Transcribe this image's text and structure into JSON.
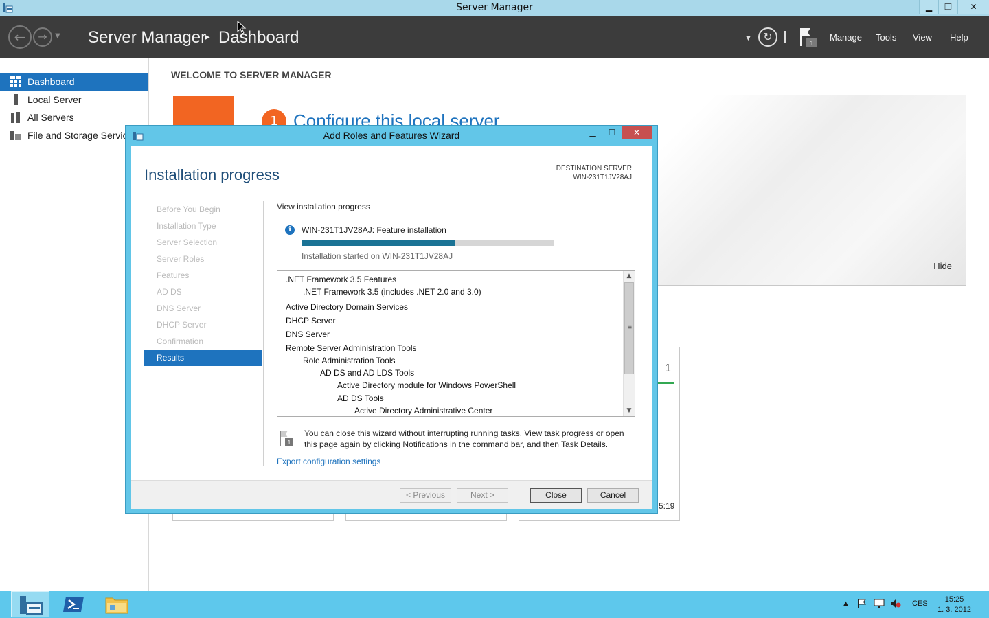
{
  "window": {
    "title": "Server Manager"
  },
  "header": {
    "breadcrumb_root": "Server Manager",
    "breadcrumb_current": "Dashboard",
    "notification_count": "1",
    "menus": [
      "Manage",
      "Tools",
      "View",
      "Help"
    ]
  },
  "sidebar": {
    "items": [
      {
        "label": "Dashboard",
        "active": true
      },
      {
        "label": "Local Server"
      },
      {
        "label": "All Servers"
      },
      {
        "label": "File and Storage Services"
      }
    ]
  },
  "main": {
    "welcome_heading": "WELCOME TO SERVER MANAGER",
    "step_number": "1",
    "configure_text": "Configure this local server",
    "hide_label": "Hide",
    "tile_count": "1",
    "tile_time": "5:19"
  },
  "dialog": {
    "title": "Add Roles and Features Wizard",
    "page_title": "Installation progress",
    "destination_label": "DESTINATION SERVER",
    "destination_server": "WIN-231T1JV28AJ",
    "steps": [
      "Before You Begin",
      "Installation Type",
      "Server Selection",
      "Server Roles",
      "Features",
      "AD DS",
      "DNS Server",
      "DHCP Server",
      "Confirmation",
      "Results"
    ],
    "active_step": "Results",
    "view_progress": "View installation progress",
    "feature_install": "WIN-231T1JV28AJ: Feature installation",
    "progress_percent": 61,
    "started_text": "Installation started on WIN-231T1JV28AJ",
    "features": [
      {
        "text": ".NET Framework 3.5 Features",
        "level": 0
      },
      {
        "text": ".NET Framework 3.5 (includes .NET 2.0 and 3.0)",
        "level": 1
      },
      {
        "text": "Active Directory Domain Services",
        "level": 0
      },
      {
        "text": "DHCP Server",
        "level": 0
      },
      {
        "text": "DNS Server",
        "level": 0
      },
      {
        "text": "Remote Server Administration Tools",
        "level": 0
      },
      {
        "text": "Role Administration Tools",
        "level": 1
      },
      {
        "text": "AD DS and AD LDS Tools",
        "level": 2
      },
      {
        "text": "Active Directory module for Windows PowerShell",
        "level": 3
      },
      {
        "text": "AD DS Tools",
        "level": 3
      },
      {
        "text": "Active Directory Administrative Center",
        "level": 4
      }
    ],
    "note_text": "You can close this wizard without interrupting running tasks. View task progress or open this page again by clicking Notifications in the command bar, and then Task Details.",
    "export_link": "Export configuration settings",
    "buttons": {
      "previous": "< Previous",
      "next": "Next >",
      "close": "Close",
      "cancel": "Cancel"
    }
  },
  "taskbar": {
    "language": "CES",
    "time": "15:25",
    "date": "1. 3. 2012"
  },
  "colors": {
    "accent": "#1e73be",
    "orange": "#f26522",
    "taskbar": "#5ec8ec",
    "dialog_frame": "#62c6e8",
    "header": "#3c3c3c"
  }
}
